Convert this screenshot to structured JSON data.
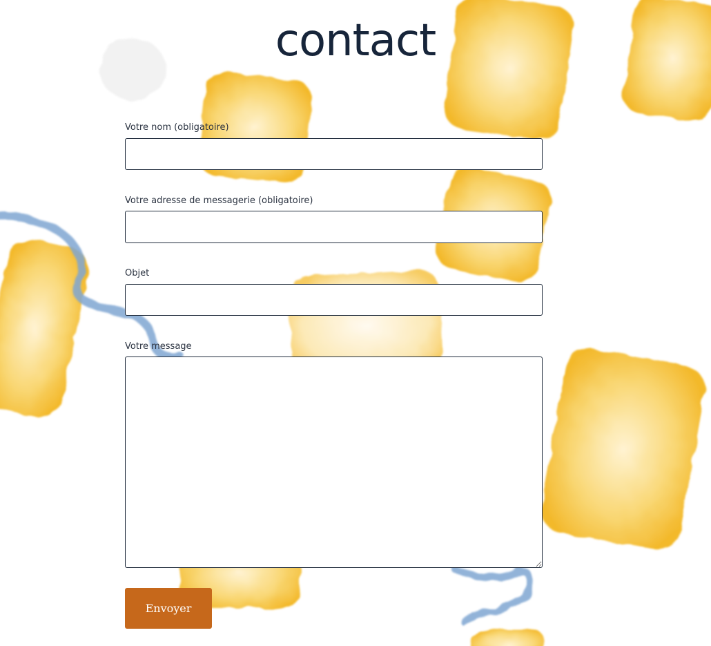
{
  "page": {
    "title": "contact"
  },
  "form": {
    "name_label": "Votre nom (obligatoire)",
    "name_value": "",
    "email_label": "Votre adresse de messagerie (obligatoire)",
    "email_value": "",
    "subject_label": "Objet",
    "subject_value": "",
    "message_label": "Votre message",
    "message_value": "",
    "submit_label": "Envoyer"
  },
  "colors": {
    "title": "#17253a",
    "button": "#c6681b",
    "watercolor_yellow": "#f6c443",
    "watercolor_blue": "#7fa6d2"
  }
}
